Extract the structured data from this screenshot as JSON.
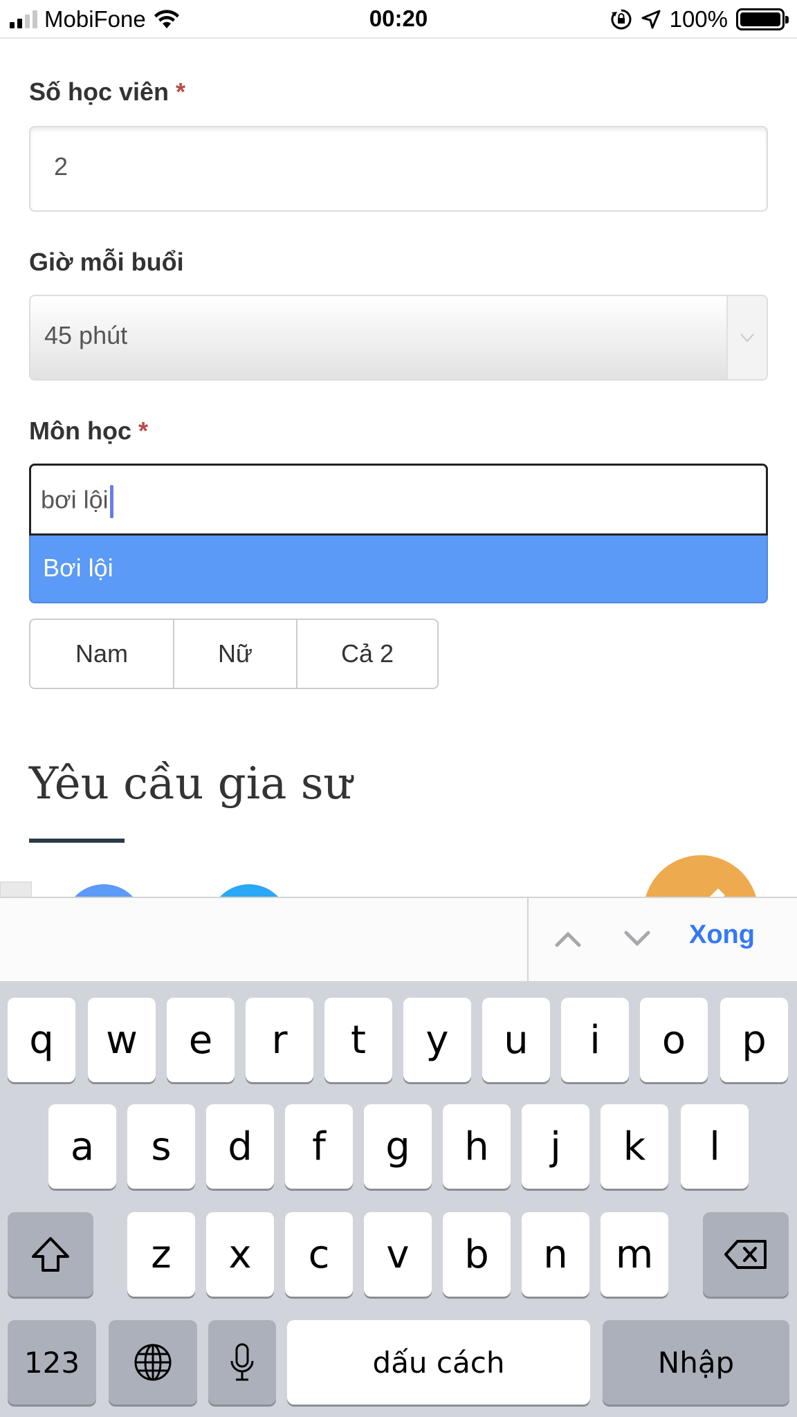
{
  "status_bar": {
    "carrier": "MobiFone",
    "time": "00:20",
    "battery_percent": "100%",
    "icons": [
      "signal-icon",
      "wifi-icon",
      "orientation-lock-icon",
      "location-arrow-icon",
      "battery-icon"
    ]
  },
  "form": {
    "students": {
      "label": "Số học viên",
      "required_mark": "*",
      "value": "2"
    },
    "duration": {
      "label": "Giờ mỗi buổi",
      "selected": "45 phút"
    },
    "subject": {
      "label": "Môn học",
      "required_mark": "*",
      "value": "bơi lội",
      "suggestion": "Bơi lội"
    },
    "gender_options": [
      "Nam",
      "Nữ",
      "Cả 2"
    ],
    "section_title": "Yêu cầu gia sư"
  },
  "accessory_bar": {
    "done_label": "Xong",
    "icons": [
      "chevron-up-icon",
      "chevron-down-icon"
    ]
  },
  "keyboard": {
    "row1": [
      "q",
      "w",
      "e",
      "r",
      "t",
      "y",
      "u",
      "i",
      "o",
      "p"
    ],
    "row2": [
      "a",
      "s",
      "d",
      "f",
      "g",
      "h",
      "j",
      "k",
      "l"
    ],
    "row3": [
      "z",
      "x",
      "c",
      "v",
      "b",
      "n",
      "m"
    ],
    "numbers_label": "123",
    "space_label": "dấu cách",
    "return_label": "Nhập",
    "icons": [
      "shift-icon",
      "backspace-icon",
      "globe-icon",
      "microphone-icon"
    ]
  },
  "colors": {
    "link_blue": "#3478f6",
    "suggestion_blue": "#5b9af6",
    "required_red": "#b94a48",
    "keyboard_bg": "#d1d4db",
    "circle_blue": "#5b9af6",
    "circle_light_blue": "#2ba8f5",
    "circle_orange": "#eeaa4e"
  }
}
